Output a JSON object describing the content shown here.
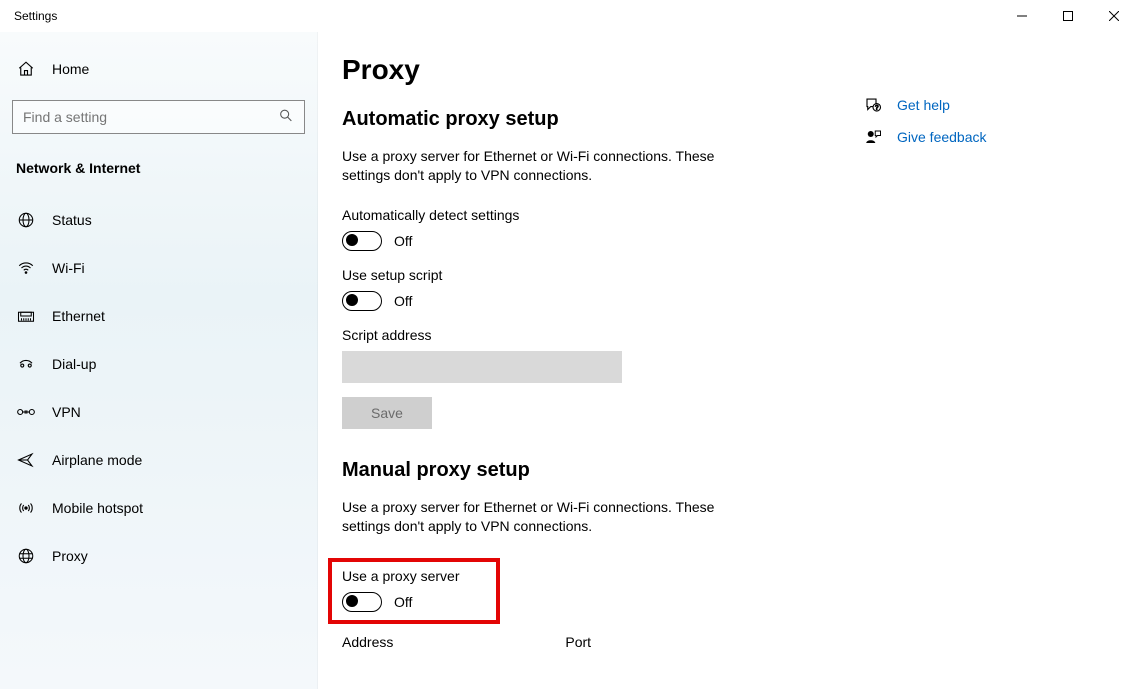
{
  "window": {
    "title": "Settings"
  },
  "sidebar": {
    "home_label": "Home",
    "search_placeholder": "Find a setting",
    "section_header": "Network & Internet",
    "items": [
      {
        "label": "Status"
      },
      {
        "label": "Wi-Fi"
      },
      {
        "label": "Ethernet"
      },
      {
        "label": "Dial-up"
      },
      {
        "label": "VPN"
      },
      {
        "label": "Airplane mode"
      },
      {
        "label": "Mobile hotspot"
      },
      {
        "label": "Proxy"
      }
    ]
  },
  "page": {
    "title": "Proxy",
    "auto": {
      "heading": "Automatic proxy setup",
      "description": "Use a proxy server for Ethernet or Wi-Fi connections. These settings don't apply to VPN connections.",
      "detect_label": "Automatically detect settings",
      "detect_state": "Off",
      "script_label": "Use setup script",
      "script_state": "Off",
      "script_address_label": "Script address",
      "script_address_value": "",
      "save_label": "Save"
    },
    "manual": {
      "heading": "Manual proxy setup",
      "description": "Use a proxy server for Ethernet or Wi-Fi connections. These settings don't apply to VPN connections.",
      "use_proxy_label": "Use a proxy server",
      "use_proxy_state": "Off",
      "address_label": "Address",
      "port_label": "Port"
    }
  },
  "help": {
    "get_help": "Get help",
    "give_feedback": "Give feedback"
  }
}
